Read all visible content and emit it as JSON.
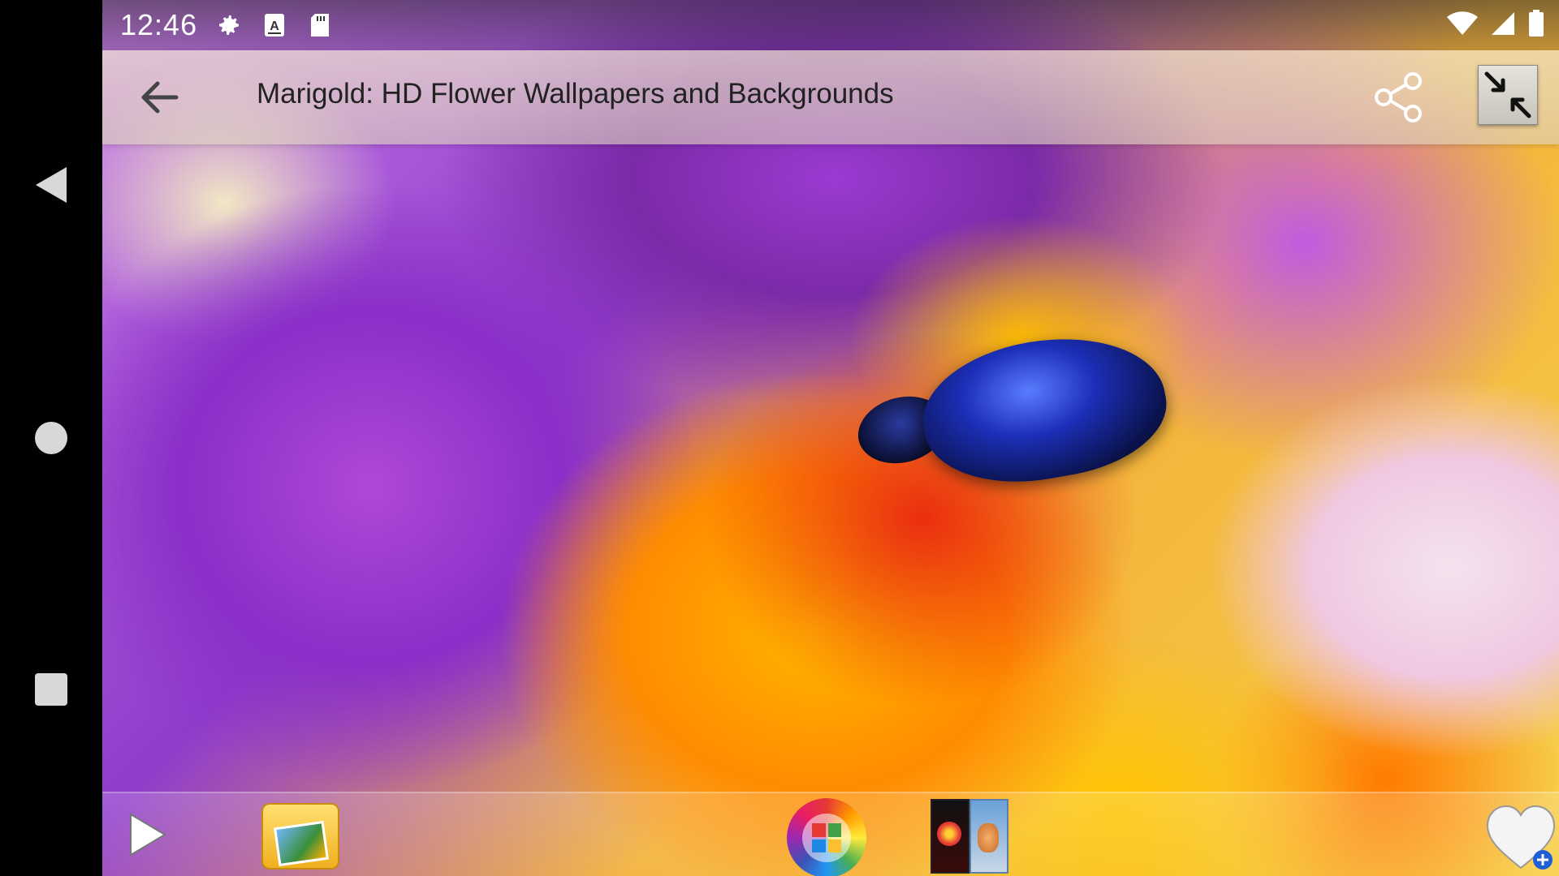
{
  "status_bar": {
    "time": "12:46",
    "icons": [
      "gear-icon",
      "a-keyboard-icon",
      "sd-card-icon"
    ],
    "right_icons": [
      "wifi-icon",
      "cell-signal-icon",
      "battery-icon"
    ]
  },
  "action_bar": {
    "title": "Marigold: HD Flower Wallpapers and Backgrounds",
    "back_icon": "arrow-left-icon",
    "share_icon": "share-icon",
    "fullscreen_icon": "exit-fullscreen-icon"
  },
  "bottom_toolbar": {
    "items": [
      "play-icon",
      "gallery-folder-icon",
      "color-wheel-icon",
      "photos-icon",
      "favorite-heart-icon"
    ]
  },
  "system_nav": {
    "items": [
      "back-triangle-icon",
      "home-circle-icon",
      "recents-square-icon"
    ]
  }
}
